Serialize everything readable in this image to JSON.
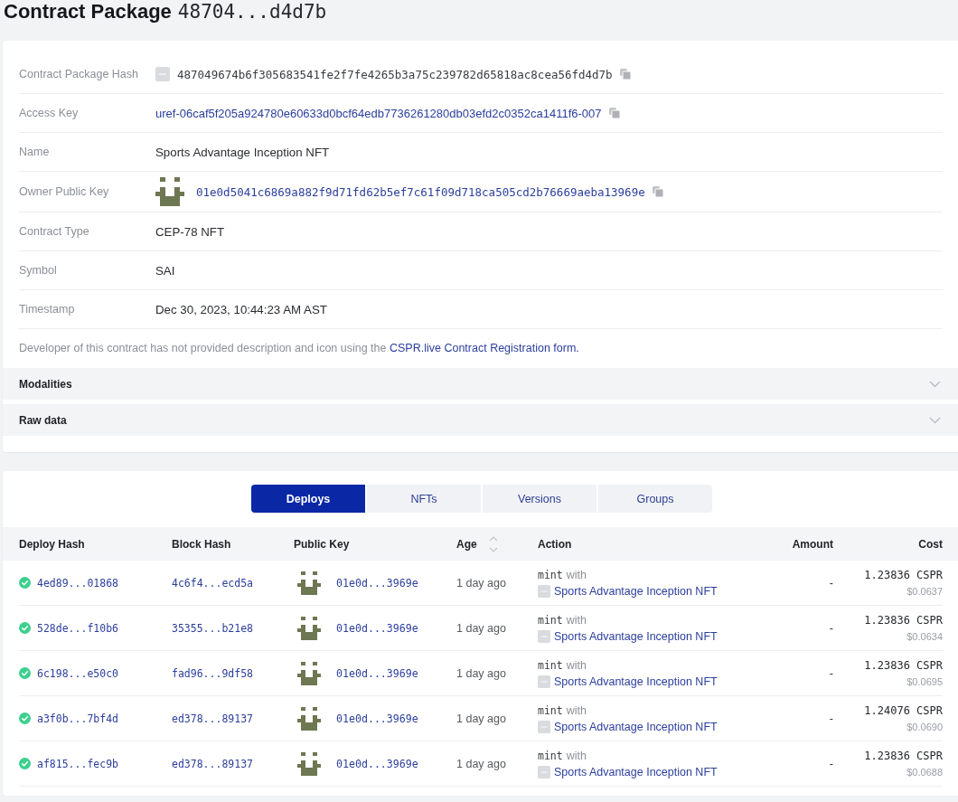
{
  "header": {
    "title": "Contract Package",
    "hash": "48704...d4d7b"
  },
  "details": [
    {
      "kind": "hash",
      "label": "Contract Package Hash",
      "value": "487049674b6f305683541fe2f7fe4265b3a75c239782d65818ac8cea56fd4d7b",
      "copyable": true
    },
    {
      "kind": "link",
      "label": "Access Key",
      "value": "uref-06caf5f205a924780e60633d0bcf64edb7736261280db03efd2c0352ca1411f6-007",
      "copyable": true
    },
    {
      "kind": "text",
      "label": "Name",
      "value": "Sports Advantage Inception NFT",
      "copyable": false
    },
    {
      "kind": "account",
      "label": "Owner Public Key",
      "value": "01e0d5041c6869a882f9d71fd62b5ef7c61f09d718ca505cd2b76669aeba13969e",
      "copyable": true
    },
    {
      "kind": "text",
      "label": "Contract Type",
      "value": "CEP-78 NFT",
      "copyable": false
    },
    {
      "kind": "text",
      "label": "Symbol",
      "value": "SAI",
      "copyable": false
    },
    {
      "kind": "text",
      "label": "Timestamp",
      "value": "Dec 30, 2023, 10:44:23 AM AST",
      "copyable": false
    }
  ],
  "note": {
    "text": "Developer of this contract has not provided description and icon using the",
    "link": "CSPR.live Contract Registration form."
  },
  "sections": [
    {
      "title": "Modalities",
      "expanded": false
    },
    {
      "title": "Raw data",
      "expanded": false
    }
  ],
  "tabs": [
    {
      "label": "Deploys",
      "selected": true
    },
    {
      "label": "NFTs",
      "selected": false
    },
    {
      "label": "Versions",
      "selected": false
    },
    {
      "label": "Groups",
      "selected": false
    }
  ],
  "table": {
    "columns": [
      {
        "label": "Deploy Hash",
        "sortable": false
      },
      {
        "label": "Block Hash",
        "sortable": false
      },
      {
        "label": "Public Key",
        "sortable": false
      },
      {
        "label": "Age",
        "sortable": true
      },
      {
        "label": "Action",
        "sortable": false
      },
      {
        "label": "Amount",
        "sortable": false
      },
      {
        "label": "Cost",
        "sortable": false
      }
    ],
    "rows": [
      {
        "succeeded": true,
        "deploy_hash": "4ed89...01868",
        "block_hash": "4c6f4...ecd5a",
        "public_key": "01e0d...3969e",
        "age": "1 day ago",
        "action": {
          "method": "mint",
          "connector": "with",
          "contract": "Sports Advantage Inception NFT"
        },
        "amount": "-",
        "cost": "1.23836 CSPR",
        "cost_usd": "$0.0637"
      },
      {
        "succeeded": true,
        "deploy_hash": "528de...f10b6",
        "block_hash": "35355...b21e8",
        "public_key": "01e0d...3969e",
        "age": "1 day ago",
        "action": {
          "method": "mint",
          "connector": "with",
          "contract": "Sports Advantage Inception NFT"
        },
        "amount": "-",
        "cost": "1.23836 CSPR",
        "cost_usd": "$0.0634"
      },
      {
        "succeeded": true,
        "deploy_hash": "6c198...e50c0",
        "block_hash": "fad96...9df58",
        "public_key": "01e0d...3969e",
        "age": "1 day ago",
        "action": {
          "method": "mint",
          "connector": "with",
          "contract": "Sports Advantage Inception NFT"
        },
        "amount": "-",
        "cost": "1.23836 CSPR",
        "cost_usd": "$0.0695"
      },
      {
        "succeeded": true,
        "deploy_hash": "a3f0b...7bf4d",
        "block_hash": "ed378...89137",
        "public_key": "01e0d...3969e",
        "age": "1 day ago",
        "action": {
          "method": "mint",
          "connector": "with",
          "contract": "Sports Advantage Inception NFT"
        },
        "amount": "-",
        "cost": "1.24076 CSPR",
        "cost_usd": "$0.0690"
      },
      {
        "succeeded": true,
        "deploy_hash": "af815...fec9b",
        "block_hash": "ed378...89137",
        "public_key": "01e0d...3969e",
        "age": "1 day ago",
        "action": {
          "method": "mint",
          "connector": "with",
          "contract": "Sports Advantage Inception NFT"
        },
        "amount": "-",
        "cost": "1.23836 CSPR",
        "cost_usd": "$0.0688"
      }
    ]
  }
}
